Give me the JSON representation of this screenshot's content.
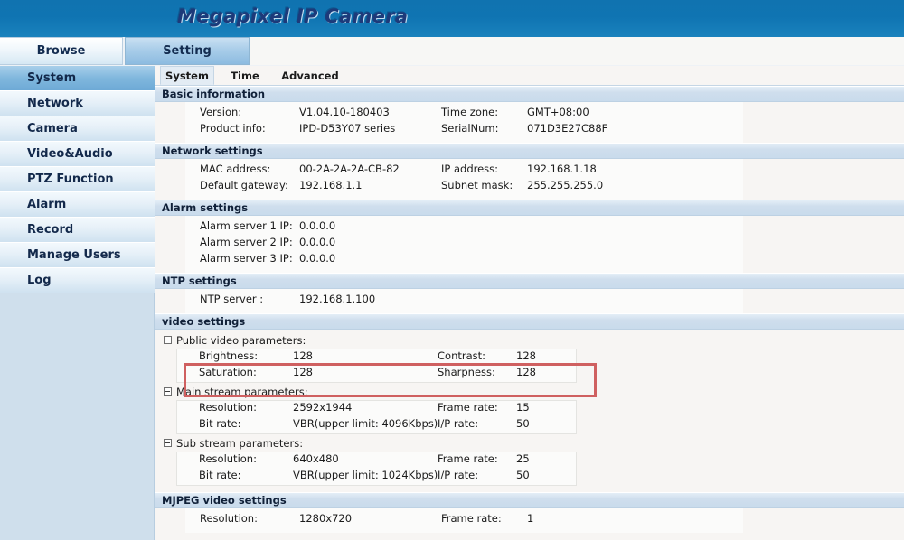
{
  "banner": {
    "title": "Megapixel IP Camera"
  },
  "toptabs": [
    {
      "label": "Browse",
      "active": false
    },
    {
      "label": "Setting",
      "active": true
    }
  ],
  "sidebar": {
    "items": [
      {
        "label": "System",
        "active": true
      },
      {
        "label": "Network",
        "active": false
      },
      {
        "label": "Camera",
        "active": false
      },
      {
        "label": "Video&Audio",
        "active": false
      },
      {
        "label": "PTZ Function",
        "active": false
      },
      {
        "label": "Alarm",
        "active": false
      },
      {
        "label": "Record",
        "active": false
      },
      {
        "label": "Manage Users",
        "active": false
      },
      {
        "label": "Log",
        "active": false
      }
    ]
  },
  "subtabs": [
    {
      "label": "System",
      "active": true
    },
    {
      "label": "Time",
      "active": false
    },
    {
      "label": "Advanced",
      "active": false
    }
  ],
  "sections": {
    "basic_information": {
      "title": "Basic information",
      "rows": [
        {
          "label1": "Version:",
          "value1": "V1.04.10-180403",
          "label2": "Time zone:",
          "value2": "GMT+08:00"
        },
        {
          "label1": "Product info:",
          "value1": "IPD-D53Y07 series",
          "label2": "SerialNum:",
          "value2": "071D3E27C88F"
        }
      ]
    },
    "network_settings": {
      "title": "Network settings",
      "rows": [
        {
          "label1": "MAC address:",
          "value1": "00-2A-2A-2A-CB-82",
          "label2": "IP address:",
          "value2": "192.168.1.18"
        },
        {
          "label1": "Default gateway:",
          "value1": "192.168.1.1",
          "label2": "Subnet mask:",
          "value2": "255.255.255.0"
        }
      ]
    },
    "alarm_settings": {
      "title": "Alarm settings",
      "rows": [
        {
          "label1": "Alarm server 1 IP:",
          "value1": "0.0.0.0",
          "label2": "",
          "value2": ""
        },
        {
          "label1": "Alarm server 2 IP:",
          "value1": "0.0.0.0",
          "label2": "",
          "value2": ""
        },
        {
          "label1": "Alarm server 3 IP:",
          "value1": "0.0.0.0",
          "label2": "",
          "value2": ""
        }
      ]
    },
    "ntp_settings": {
      "title": "NTP settings",
      "rows": [
        {
          "label1": "NTP server :",
          "value1": "192.168.1.100",
          "label2": "",
          "value2": ""
        }
      ]
    },
    "video_settings": {
      "title": "video settings",
      "groups": [
        {
          "name": "Public video parameters:",
          "icon": "collapse-minus-icon",
          "rows": [
            {
              "label1": "Brightness:",
              "value1": "128",
              "label2": "Contrast:",
              "value2": "128"
            },
            {
              "label1": "Saturation:",
              "value1": "128",
              "label2": "Sharpness:",
              "value2": "128"
            }
          ]
        },
        {
          "name": "Main stream parameters:",
          "icon": "collapse-minus-icon",
          "rows": [
            {
              "label1": "Resolution:",
              "value1": "2592x1944",
              "label2": "Frame rate:",
              "value2": "15"
            },
            {
              "label1": "Bit rate:",
              "value1": "VBR(upper limit: 4096Kbps)",
              "label2": "I/P rate:",
              "value2": "50"
            }
          ]
        },
        {
          "name": "Sub stream parameters:",
          "icon": "collapse-minus-icon",
          "rows": [
            {
              "label1": "Resolution:",
              "value1": "640x480",
              "label2": "Frame rate:",
              "value2": "25"
            },
            {
              "label1": "Bit rate:",
              "value1": "VBR(upper limit: 1024Kbps)",
              "label2": "I/P rate:",
              "value2": "50"
            }
          ]
        }
      ]
    },
    "mjpeg_video_settings": {
      "title": "MJPEG video settings",
      "rows": [
        {
          "label1": "Resolution:",
          "value1": "1280x720",
          "label2": "Frame rate:",
          "value2": "1"
        }
      ]
    }
  },
  "annotation": {
    "type": "red-rectangle-highlight",
    "color": "#cf6060",
    "targets": [
      "Main stream parameters:",
      "Resolution: 2592x1944",
      "Frame rate: 15"
    ]
  }
}
